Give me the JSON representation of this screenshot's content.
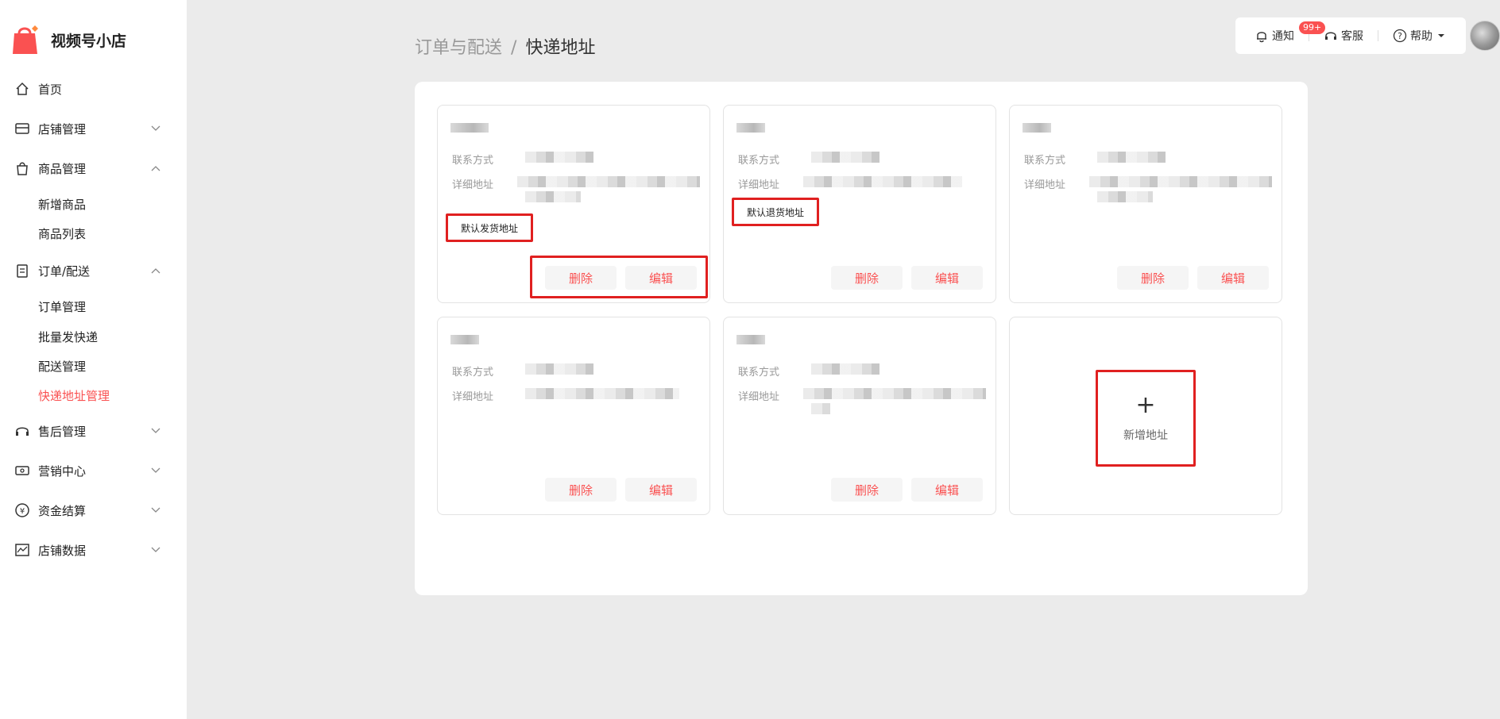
{
  "app": {
    "title": "视频号小店",
    "brand_color": "#fa5151"
  },
  "sidebar": {
    "items": [
      {
        "label": "首页",
        "icon": "home-icon"
      },
      {
        "label": "店铺管理",
        "icon": "store-icon",
        "expanded": false
      },
      {
        "label": "商品管理",
        "icon": "bag-icon",
        "expanded": true
      },
      {
        "label": "订单/配送",
        "icon": "clipboard-icon",
        "expanded": true
      },
      {
        "label": "售后管理",
        "icon": "headset-icon",
        "expanded": false
      },
      {
        "label": "营销中心",
        "icon": "ticket-icon",
        "expanded": false
      },
      {
        "label": "资金结算",
        "icon": "yuan-icon",
        "expanded": false
      },
      {
        "label": "店铺数据",
        "icon": "chart-icon",
        "expanded": false
      }
    ],
    "product_sub": [
      "新增商品",
      "商品列表"
    ],
    "order_sub": [
      "订单管理",
      "批量发快递",
      "配送管理",
      "快递地址管理"
    ],
    "active_sub": "快递地址管理"
  },
  "topbar": {
    "notify_label": "通知",
    "notify_badge": "99+",
    "service_label": "客服",
    "help_label": "帮助"
  },
  "breadcrumb": {
    "parent": "订单与配送",
    "sep": "/",
    "current": "快递地址"
  },
  "address_cards": {
    "contact_label": "联系方式",
    "detail_label": "详细地址",
    "delete_label": "删除",
    "edit_label": "编辑",
    "default_ship_tag": "默认发货地址",
    "default_return_tag": "默认退货地址"
  },
  "add_address": {
    "label": "新增地址",
    "plus": "+"
  }
}
